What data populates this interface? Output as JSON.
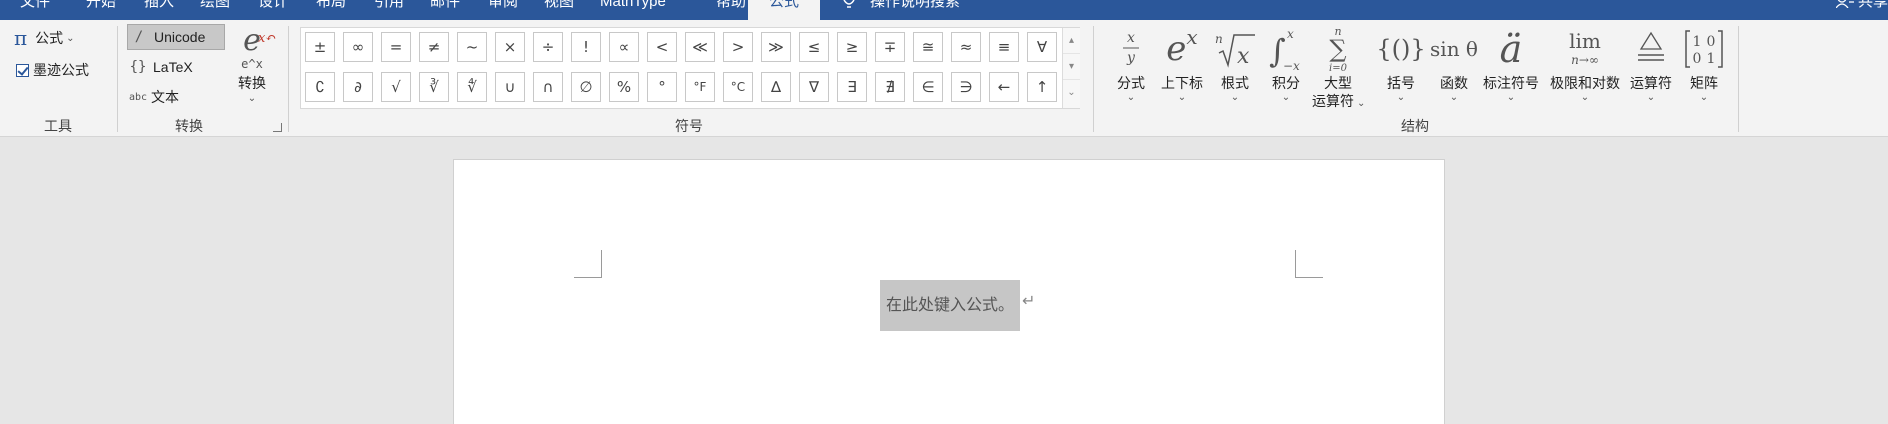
{
  "tabs": [
    "文件",
    "开始",
    "插入",
    "绘图",
    "设计",
    "布局",
    "引用",
    "邮件",
    "审阅",
    "视图",
    "MathType",
    "帮助",
    "公式"
  ],
  "tell_me": "操作说明搜索",
  "share": "共享",
  "tools": {
    "equation_label": "公式",
    "ink_label": "墨迹公式",
    "group": "工具"
  },
  "conversions": {
    "unicode": "Unicode",
    "latex": "LaTeX",
    "text": "文本",
    "text_prefix": "abc",
    "convert": "转换",
    "convert_sub": "e^x",
    "group": "转换"
  },
  "symbols": {
    "group": "符号",
    "row1": [
      "±",
      "∞",
      "=",
      "≠",
      "~",
      "×",
      "÷",
      "!",
      "∝",
      "<",
      "≪",
      ">",
      "≫",
      "≤",
      "≥",
      "∓",
      "≅",
      "≈",
      "≡",
      "∀"
    ],
    "row2": [
      "∁",
      "∂",
      "√",
      "∛",
      "∜",
      "∪",
      "∩",
      "∅",
      "%",
      "°",
      "°F",
      "°C",
      "∆",
      "∇",
      "∃",
      "∄",
      "∈",
      "∋",
      "←",
      "↑"
    ]
  },
  "structures": {
    "group": "结构",
    "items": [
      {
        "label": "分式",
        "glyph": "x/y"
      },
      {
        "label": "上下标",
        "glyph": "eˣ"
      },
      {
        "label": "根式",
        "glyph": "ⁿ√x"
      },
      {
        "label": "积分",
        "glyph": "∫"
      },
      {
        "label": "大型",
        "label2": "运算符",
        "glyph": "∑"
      },
      {
        "label": "括号",
        "glyph": "{()}"
      },
      {
        "label": "函数",
        "glyph": "sinθ"
      },
      {
        "label": "标注符号",
        "glyph": "ä"
      },
      {
        "label": "极限和对数",
        "glyph": "lim n→∞"
      },
      {
        "label": "运算符",
        "glyph": "≜"
      },
      {
        "label": "矩阵",
        "glyph": "[1 0; 0 1]"
      }
    ]
  },
  "document": {
    "placeholder": "在此处键入公式。",
    "return_mark": "↵"
  },
  "colors": {
    "accent": "#2b579a",
    "ribbon": "#f3f3f3",
    "canvas": "#e6e6e6"
  }
}
